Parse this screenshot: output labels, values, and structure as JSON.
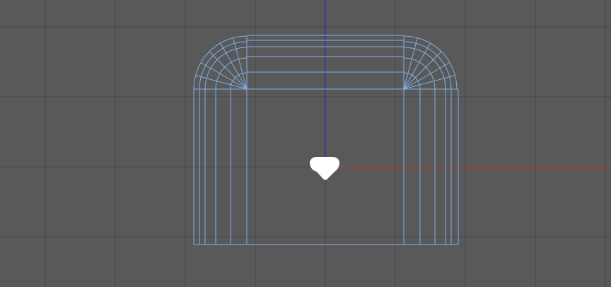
{
  "viewport": {
    "view": "front",
    "projection": "orthographic",
    "grid": true,
    "background_color": "#595959",
    "grid_color": "#474747"
  },
  "axes": {
    "x_axis_color": "#c4302b",
    "z_axis_color": "#1f1fd6"
  },
  "mesh": {
    "display": "wireframe",
    "wire_color": "#7fb0e6",
    "shape": "rounded-arch"
  },
  "pivot": {
    "icon": "camera-pivot-icon",
    "color": "#ffffff"
  }
}
